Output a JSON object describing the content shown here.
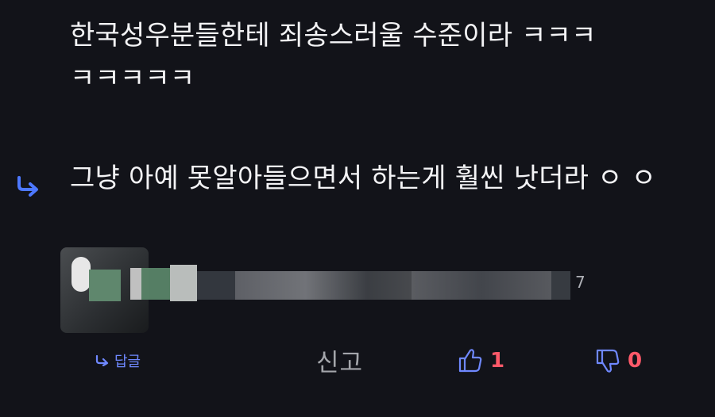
{
  "comments": [
    {
      "text": "한국성우분들한테 죄송스러울 수준이라 ㅋㅋㅋ ㅋㅋㅋㅋㅋ"
    },
    {
      "text": "그냥 아예 못알아들으면서 하는게 훨씬 낫더라 ㅇ ㅇ"
    }
  ],
  "meta": {
    "count": "7"
  },
  "actions": {
    "reply_label": "답글",
    "report_label": "신고",
    "likes": "1",
    "dislikes": "0"
  },
  "colors": {
    "background": "#121319",
    "text": "#f3f3f5",
    "accent": "#6f88ff",
    "muted": "#a4a6ab",
    "vote_count": "#ff5969"
  },
  "icons": {
    "reply_arrow": "reply-arrow-icon",
    "thumbs_up": "thumbs-up-icon",
    "thumbs_down": "thumbs-down-icon"
  }
}
